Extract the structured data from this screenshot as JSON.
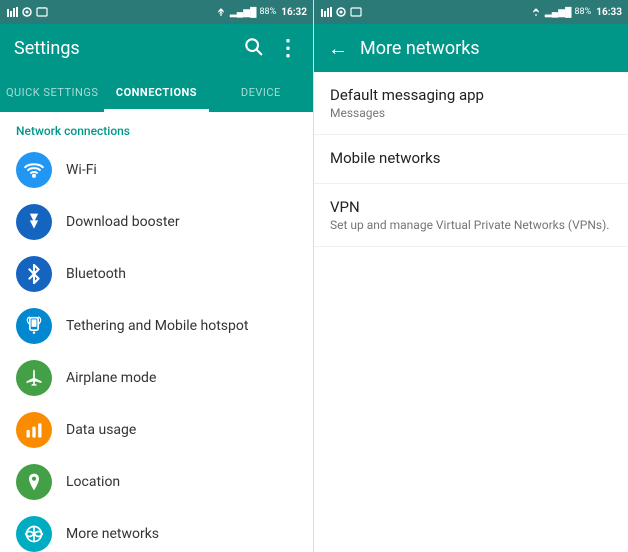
{
  "left": {
    "statusBar": {
      "time": "16:32",
      "battery": "88%"
    },
    "appBar": {
      "title": "Settings",
      "searchIcon": "🔍",
      "moreIcon": "⋮"
    },
    "tabs": [
      {
        "id": "quick",
        "label": "QUICK SETTINGS",
        "active": false
      },
      {
        "id": "connections",
        "label": "CONNECTIONS",
        "active": true
      },
      {
        "id": "device",
        "label": "DEVICE",
        "active": false
      }
    ],
    "sectionLabel": "Network connections",
    "menuItems": [
      {
        "id": "wifi",
        "icon": "wifi",
        "label": "Wi-Fi",
        "color": "ic-wifi"
      },
      {
        "id": "download",
        "icon": "bolt",
        "label": "Download booster",
        "color": "ic-download"
      },
      {
        "id": "bluetooth",
        "icon": "bluetooth",
        "label": "Bluetooth",
        "color": "ic-bluetooth"
      },
      {
        "id": "tethering",
        "icon": "tether",
        "label": "Tethering and Mobile hotspot",
        "color": "ic-tethering"
      },
      {
        "id": "airplane",
        "icon": "plane",
        "label": "Airplane mode",
        "color": "ic-airplane"
      },
      {
        "id": "data",
        "icon": "data",
        "label": "Data usage",
        "color": "ic-data"
      },
      {
        "id": "location",
        "icon": "pin",
        "label": "Location",
        "color": "ic-location"
      },
      {
        "id": "more",
        "icon": "more",
        "label": "More networks",
        "color": "ic-more"
      }
    ]
  },
  "right": {
    "statusBar": {
      "time": "16:33",
      "battery": "88%"
    },
    "appBar": {
      "backIcon": "←",
      "title": "More networks"
    },
    "items": [
      {
        "id": "default-msg",
        "title": "Default messaging app",
        "subtitle": "Messages"
      },
      {
        "id": "mobile-networks",
        "title": "Mobile networks",
        "subtitle": ""
      },
      {
        "id": "vpn",
        "title": "VPN",
        "subtitle": "Set up and manage Virtual Private Networks (VPNs)."
      }
    ]
  },
  "icons": {
    "wifi_glyph": "📶",
    "bolt_glyph": "⚡",
    "bluetooth_glyph": "🔷",
    "tether_glyph": "📱",
    "plane_glyph": "✈",
    "data_glyph": "📊",
    "pin_glyph": "📍",
    "more_glyph": "📡"
  }
}
